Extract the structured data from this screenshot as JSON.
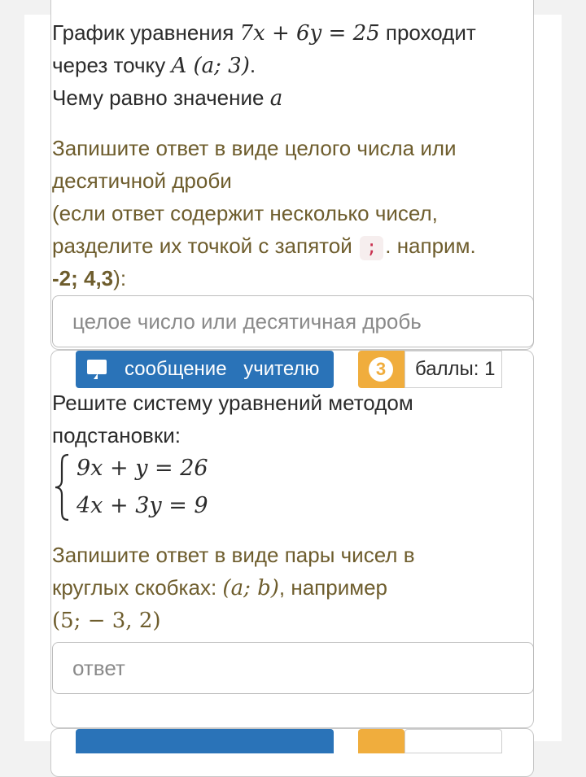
{
  "q2": {
    "line1_prefix": "График уравнения ",
    "equation": "7x + 6y = 25",
    "line1_suffix": " проходит",
    "line2_prefix": "через точку ",
    "point": "A (a; 3)",
    "line2_suffix": ".",
    "line3_prefix": "Чему равно значение ",
    "variable": "a",
    "hint_line1": "Запишите ответ в виде целого числа или",
    "hint_line2": "десятичной дроби",
    "hint_line3": "(если ответ содержит несколько чисел,",
    "hint_line4_prefix": "разделите их точкой с запятой ",
    "hint_separator": ";",
    "hint_line4_suffix": ". наприм.",
    "hint_example": "-2; 4,3",
    "hint_end": "):",
    "input_placeholder": "целое число или десятичная дробь"
  },
  "q3": {
    "message_button": "сообщение учителю",
    "number": "3",
    "points": "баллы: 1",
    "line1": "Решите систему уравнений методом",
    "line2": "подстановки:",
    "eq1": "9x + y = 26",
    "eq2": "4x + 3y = 9",
    "hint_line1": "Запишите ответ в виде пары чисел в",
    "hint_line2_prefix": "круглых скобках: ",
    "hint_pair": "(a; b)",
    "hint_line2_suffix": ", например",
    "hint_example": "(5;  − 3, 2)",
    "input_placeholder": "ответ"
  },
  "colors": {
    "accent_blue": "#2a73b8",
    "badge_orange": "#f0ad3d",
    "hint_text": "#6e5d2d",
    "code_red": "#c9304f"
  },
  "icons": {
    "message": "chat-bubble-icon"
  }
}
